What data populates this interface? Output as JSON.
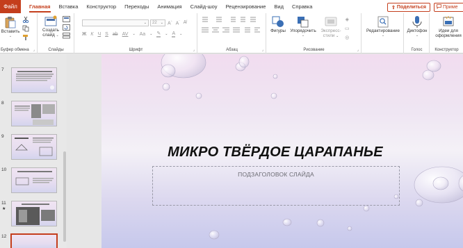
{
  "tabs": {
    "file": "Файл",
    "items": [
      "Главная",
      "Вставка",
      "Конструктор",
      "Переходы",
      "Анимация",
      "Слайд-шоу",
      "Рецензирование",
      "Вид",
      "Справка"
    ],
    "active_index": 0
  },
  "header_buttons": {
    "share": "Поделиться",
    "comments": "Приме"
  },
  "ribbon": {
    "clipboard": {
      "paste": "Вставить",
      "label": "Буфер обмена"
    },
    "slides": {
      "new_slide_line1": "Создать",
      "new_slide_line2": "слайд",
      "label": "Слайды"
    },
    "font": {
      "font_name": "",
      "font_size": "22",
      "bold": "Ж",
      "italic": "К",
      "underline": "Ч",
      "strike": "S",
      "shadow": "ab",
      "spacing": "AV",
      "case": "Aa",
      "label": "Шрифт"
    },
    "paragraph": {
      "label": "Абзац"
    },
    "drawing": {
      "shapes": "Фигуры",
      "arrange": "Упорядочить",
      "quick_styles_line1": "Экспресс-",
      "quick_styles_line2": "стили",
      "label": "Рисование"
    },
    "editing": {
      "edit": "Редактирование"
    },
    "voice": {
      "dictate": "Диктофон",
      "label": "Голос"
    },
    "designer": {
      "ideas_line1": "Идеи для",
      "ideas_line2": "оформления",
      "label": "Конструктор"
    }
  },
  "thumbnails": [
    {
      "number": "7",
      "star": ""
    },
    {
      "number": "8",
      "star": ""
    },
    {
      "number": "9",
      "star": ""
    },
    {
      "number": "10",
      "star": ""
    },
    {
      "number": "11",
      "star": "★"
    },
    {
      "number": "12",
      "star": ""
    }
  ],
  "slide": {
    "title": "МИКРО ТВЁРДОЕ ЦАРАПАНЬЕ",
    "subtitle_placeholder": "ПОДЗАГОЛОВОК СЛАЙДА"
  },
  "colors": {
    "accent": "#c43e1c",
    "slide_top": "#f1dcef",
    "slide_bottom": "#c6c8ec"
  }
}
